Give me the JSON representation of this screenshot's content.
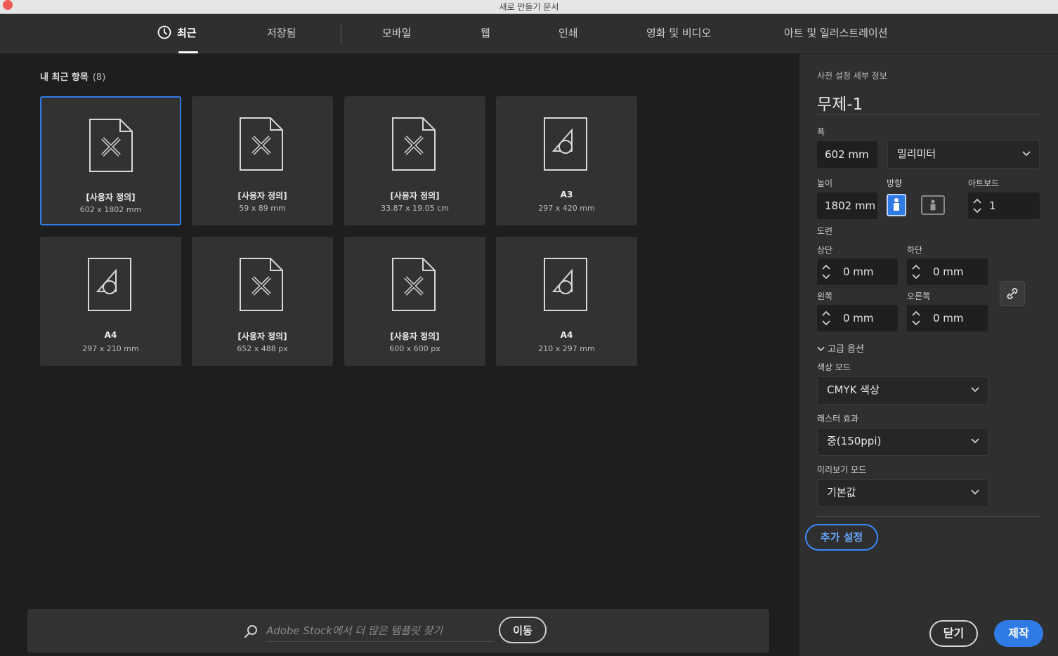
{
  "window": {
    "title": "새로 만들기 문서"
  },
  "tabs": [
    {
      "label": "최근"
    },
    {
      "label": "저장됨"
    },
    {
      "label": "모바일"
    },
    {
      "label": "웹"
    },
    {
      "label": "인쇄"
    },
    {
      "label": "영화 및 비디오"
    },
    {
      "label": "아트 및 일러스트레이션"
    }
  ],
  "recent": {
    "title": "내 최근 항목",
    "count": "(8)",
    "items": [
      {
        "icon": "custom-document-icon",
        "name": "[사용자 정의]",
        "size": "602 x 1802 mm"
      },
      {
        "icon": "custom-document-icon",
        "name": "[사용자 정의]",
        "size": "59 x 89 mm"
      },
      {
        "icon": "custom-document-icon",
        "name": "[사용자 정의]",
        "size": "33.87 x 19.05 cm"
      },
      {
        "icon": "shapes-document-icon",
        "name": "A3",
        "size": "297 x 420 mm"
      },
      {
        "icon": "shapes-document-icon",
        "name": "A4",
        "size": "297 x 210 mm"
      },
      {
        "icon": "custom-document-icon",
        "name": "[사용자 정의]",
        "size": "652 x 488 px"
      },
      {
        "icon": "custom-document-icon",
        "name": "[사용자 정의]",
        "size": "600 x 600 px"
      },
      {
        "icon": "shapes-document-icon",
        "name": "A4",
        "size": "210 x 297 mm"
      }
    ]
  },
  "search": {
    "placeholder": "Adobe Stock에서 더 많은 템플릿 찾기",
    "go_label": "이동"
  },
  "preset": {
    "section_label": "사전 설정 세부 정보",
    "doc_name": "무제-1",
    "width_label": "폭",
    "width_value": "602 mm",
    "unit": "밀리미터",
    "height_label": "높이",
    "height_value": "1802 mm",
    "orientation_label": "방향",
    "artboard_label": "아트보드",
    "artboard_value": "1",
    "bleed_label": "도련",
    "top_label": "상단",
    "top_value": "0 mm",
    "bottom_label": "하단",
    "bottom_value": "0 mm",
    "left_label": "왼쪽",
    "left_value": "0 mm",
    "right_label": "오른쪽",
    "right_value": "0 mm",
    "advanced_label": "고급 옵션",
    "color_mode_label": "색상 모드",
    "color_mode_value": "CMYK 색상",
    "raster_label": "래스터 효과",
    "raster_value": "중(150ppi)",
    "preview_label": "미리보기 모드",
    "preview_value": "기본값",
    "more_settings": "추가 설정",
    "close": "닫기",
    "create": "제작"
  },
  "colors": {
    "accent": "#2f7ae5",
    "panel": "#2f2f2f",
    "background": "#1e1e1e"
  }
}
